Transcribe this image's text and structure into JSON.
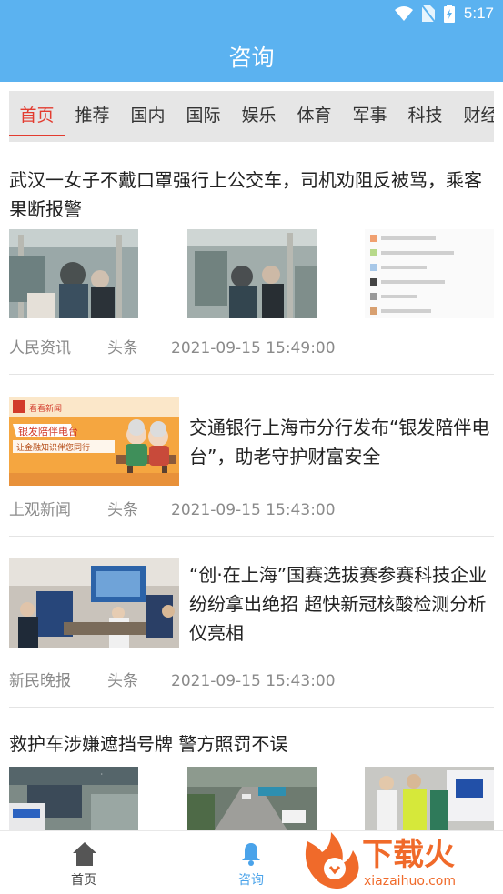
{
  "status_bar": {
    "time": "5:17"
  },
  "header": {
    "title": "咨询"
  },
  "tabs": [
    {
      "label": "首页",
      "active": true
    },
    {
      "label": "推荐"
    },
    {
      "label": "国内"
    },
    {
      "label": "国际"
    },
    {
      "label": "娱乐"
    },
    {
      "label": "体育"
    },
    {
      "label": "军事"
    },
    {
      "label": "科技"
    },
    {
      "label": "财经"
    }
  ],
  "news": [
    {
      "title": "武汉一女子不戴口罩强行上公交车，司机劝阻反被骂，乘客果断报警",
      "source": "人民资讯",
      "tag": "头条",
      "time": "2021-09-15 15:49:00"
    },
    {
      "title": "交通银行上海市分行发布“银发陪伴电台”，助老守护财富安全",
      "source": "上观新闻",
      "tag": "头条",
      "time": "2021-09-15 15:43:00",
      "image_text": {
        "brand": "看看新闻",
        "headline1": "银发陪伴电台",
        "headline2": "让金融知识伴您同行"
      }
    },
    {
      "title": "“创·在上海”国赛选拔赛参赛科技企业纷纷拿出绝招 超快新冠核酸检测分析仪亮相",
      "source": "新民晚报",
      "tag": "头条",
      "time": "2021-09-15 15:43:00"
    },
    {
      "title": "救护车涉嫌遮挡号牌 警方照罚不误"
    }
  ],
  "bottom_nav": [
    {
      "label": "首页",
      "icon": "home-icon",
      "active": false
    },
    {
      "label": "咨询",
      "icon": "bell-icon",
      "active": true
    }
  ],
  "watermark": {
    "brand": "下载火",
    "url": "xiazaihuo.com"
  },
  "colors": {
    "primary": "#5bb2f0",
    "tab_active": "#e33b2f",
    "nav_active": "#4aa3ea",
    "watermark": "#f06a2a"
  }
}
